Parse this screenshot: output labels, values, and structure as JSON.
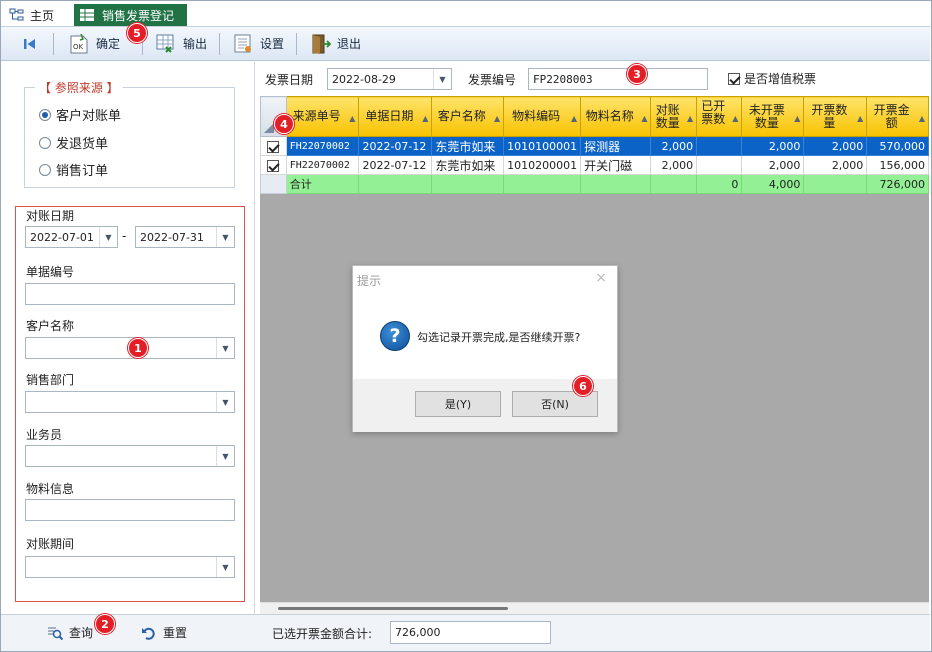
{
  "tabs": {
    "home": "主页",
    "active": "销售发票登记"
  },
  "toolbar": {
    "confirm": "确定",
    "export": "输出",
    "settings": "设置",
    "exit": "退出"
  },
  "source": {
    "title": "【 参照来源 】",
    "options": [
      "客户对账单",
      "发退货单",
      "销售订单"
    ],
    "selected": 0
  },
  "filters": {
    "recon_date_label": "对账日期",
    "date_from": "2022-07-01",
    "date_to": "2022-07-31",
    "dash": "-",
    "doc_no_label": "单据编号",
    "doc_no": "",
    "customer_label": "客户名称",
    "customer": "",
    "dept_label": "销售部门",
    "dept": "",
    "salesman_label": "业务员",
    "salesman": "",
    "material_label": "物料信息",
    "material": "",
    "period_label": "对账期间",
    "period": ""
  },
  "bottom": {
    "query": "查询",
    "reset": "重置",
    "total_label": "已选开票金额合计:",
    "total_value": "726,000"
  },
  "invoice": {
    "date_label": "发票日期",
    "date": "2022-08-29",
    "no_label": "发票编号",
    "no": "FP2208003",
    "vat_label": "是否增值税票",
    "vat_checked": true
  },
  "grid": {
    "columns": [
      "来源单号",
      "单据日期",
      "客户名称",
      "物料编码",
      "物料名称",
      "对账\n数量",
      "已开\n票数",
      "未开票\n数量",
      "开票数量",
      "开票金额"
    ],
    "rows": [
      {
        "checked": true,
        "selected": true,
        "cells": [
          "FH22070002",
          "2022-07-12",
          "东莞市如来",
          "1010100001",
          "探测器",
          "2,000",
          "",
          "2,000",
          "2,000",
          "570,000"
        ]
      },
      {
        "checked": true,
        "selected": false,
        "cells": [
          "FH22070002",
          "2022-07-12",
          "东莞市如来",
          "1010200001",
          "开关门磁",
          "2,000",
          "",
          "2,000",
          "2,000",
          "156,000"
        ]
      }
    ],
    "summary": [
      "合计",
      "",
      "",
      "",
      "",
      "",
      "0",
      "4,000",
      "",
      "726,000"
    ]
  },
  "dialog": {
    "title": "提示",
    "message": "勾选记录开票完成,是否继续开票?",
    "yes": "是(Y)",
    "no": "否(N)",
    "close": "×"
  },
  "badges": [
    "1",
    "2",
    "3",
    "4",
    "5",
    "6"
  ],
  "colors": {
    "accent": "#217346",
    "selected_row": "#0c63c7",
    "header": "#f7c200",
    "summary": "#94f094",
    "badge": "#e41e26"
  }
}
